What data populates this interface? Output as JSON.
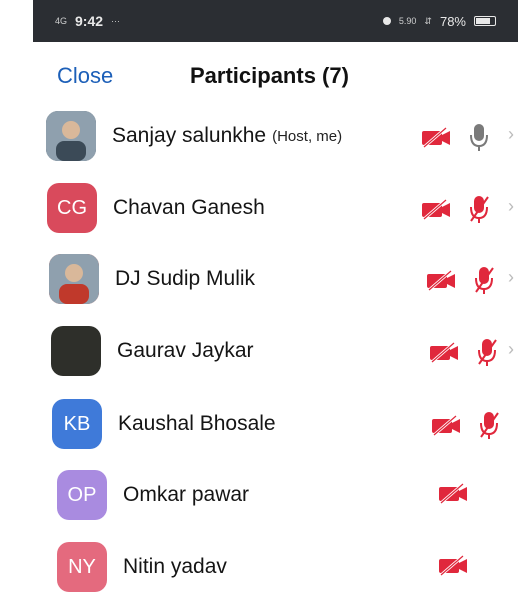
{
  "status_bar": {
    "time": "9:42",
    "carrier_glyph": "4G",
    "more": "···",
    "network_small": "5.90",
    "battery": "78%",
    "battery_level": 0.78,
    "icons": [
      "alarm-icon",
      "signal-icon",
      "wifi-icon",
      "battery-icon"
    ]
  },
  "header": {
    "close_label": "Close",
    "title": "Participants (7)",
    "accent_color": "#1c5fb8"
  },
  "participants": [
    {
      "name": "Sanjay salunkhe",
      "tag": "(Host, me)",
      "avatar_type": "photo",
      "initials": "",
      "color": "#3b4a57",
      "video_muted": true,
      "audio": "on",
      "chevron": true
    },
    {
      "name": "Chavan Ganesh",
      "tag": "",
      "avatar_type": "initials",
      "initials": "CG",
      "color": "#d94a5c",
      "video_muted": true,
      "audio": "muted",
      "chevron": true
    },
    {
      "name": "DJ Sudip Mulik",
      "tag": "",
      "avatar_type": "photo",
      "initials": "",
      "color": "#c0392b",
      "video_muted": true,
      "audio": "muted",
      "chevron": true
    },
    {
      "name": "Gaurav Jaykar",
      "tag": "",
      "avatar_type": "dark",
      "initials": "",
      "color": "#2e2f2a",
      "video_muted": true,
      "audio": "muted",
      "chevron": true
    },
    {
      "name": "Kaushal Bhosale",
      "tag": "",
      "avatar_type": "initials",
      "initials": "KB",
      "color": "#3f7ad9",
      "video_muted": true,
      "audio": "muted",
      "chevron": false
    },
    {
      "name": "Omkar pawar",
      "tag": "",
      "avatar_type": "initials",
      "initials": "OP",
      "color": "#a98be0",
      "video_muted": true,
      "audio": "none",
      "chevron": false
    },
    {
      "name": "Nitin yadav",
      "tag": "",
      "avatar_type": "initials",
      "initials": "NY",
      "color": "#e46a7e",
      "video_muted": true,
      "audio": "none",
      "chevron": false
    }
  ],
  "muted_color": "#e0283c"
}
